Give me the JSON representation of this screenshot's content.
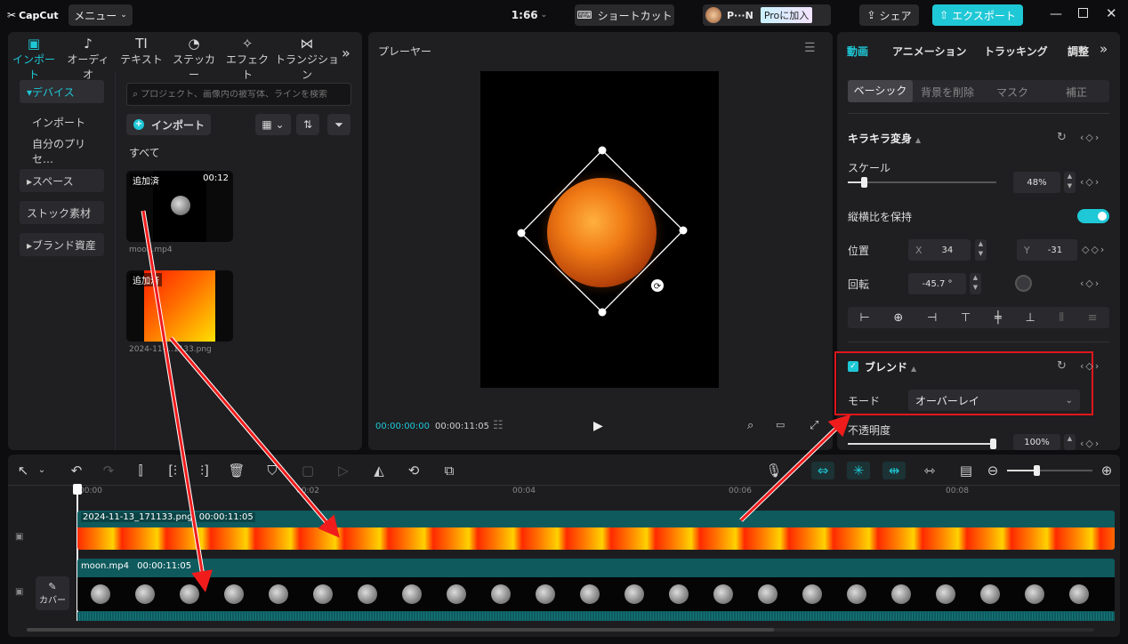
{
  "app": {
    "logo": "CapCut",
    "menu_label": "メニュー",
    "ratio": "1:66",
    "shortcut_label": "ショートカット",
    "user_name": "P···N",
    "pro_label": "Proに加入",
    "share_label": "シェア",
    "export_label": "エクスポート"
  },
  "media_tabs": [
    {
      "label": "インポート",
      "icon": "import-icon"
    },
    {
      "label": "オーディオ",
      "icon": "audio-icon"
    },
    {
      "label": "テキスト",
      "icon": "text-icon"
    },
    {
      "label": "ステッカー",
      "icon": "sticker-icon"
    },
    {
      "label": "エフェクト",
      "icon": "effect-icon"
    },
    {
      "label": "トランジション",
      "icon": "transition-icon"
    }
  ],
  "sidebar": {
    "items": [
      "▾デバイス",
      "インポート",
      "自分のプリセ…",
      "▸スペース",
      "ストック素材",
      "▸ブランド資産"
    ]
  },
  "media": {
    "search_placeholder": "プロジェクト、画像内の被写体、ラインを検索",
    "import_button": "インポート",
    "all_label": "すべて",
    "items": [
      {
        "badge": "追加済",
        "duration": "00:12",
        "name": "moon.mp4"
      },
      {
        "badge": "追加済",
        "duration": "",
        "name": "2024-11-…1133.png"
      }
    ]
  },
  "player": {
    "title": "プレーヤー",
    "current_time": "00:00:00:00",
    "total_time": "00:00:11:05"
  },
  "right_panel": {
    "tabs": [
      "動画",
      "アニメーション",
      "トラッキング",
      "調整"
    ],
    "subtabs": [
      "ベーシック",
      "背景を削除",
      "マスク",
      "補正"
    ],
    "section_beauty": "キラキラ変身",
    "scale_label": "スケール",
    "scale_value": "48%",
    "scale_level": 0.48,
    "keep_ratio_label": "縦横比を保持",
    "keep_ratio_on": true,
    "position_label": "位置",
    "pos_x_label": "X",
    "pos_x": "34",
    "pos_y_label": "Y",
    "pos_y": "-31",
    "rotation_label": "回転",
    "rotation_value": "-45.7 °",
    "blend_label": "ブレンド",
    "mode_label": "モード",
    "mode_value": "オーバーレイ",
    "opacity_label": "不透明度",
    "opacity_value": "100%",
    "opacity_level": 1.0
  },
  "timeline": {
    "ticks": [
      "00:00",
      "00:02",
      "00:04",
      "00:06",
      "00:08"
    ],
    "clip1_name": "2024-11-13_171133.png",
    "clip1_duration": "00:00:11:05",
    "clip2_name": "moon.mp4",
    "clip2_duration": "00:00:11:05",
    "cover_label": "カバー"
  },
  "colors": {
    "accent": "#1fc8d6",
    "clip_teal": "#0f5a5d",
    "red_highlight": "#e0161b",
    "arrow_red": "#f01c1c"
  }
}
